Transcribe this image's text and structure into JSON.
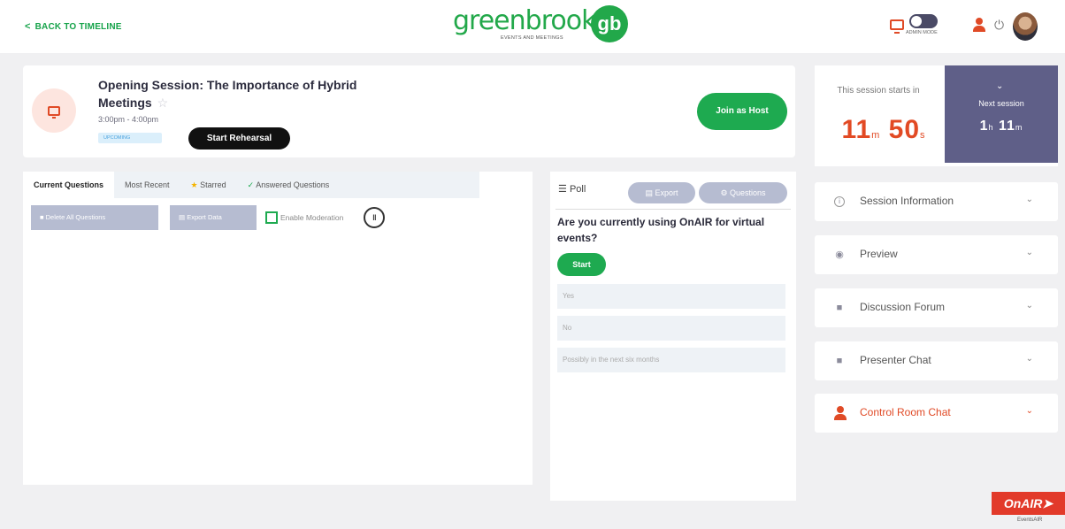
{
  "topbar": {
    "back_label": "BACK TO TIMELINE",
    "logo_text": "greenbrook",
    "logo_badge": "gb",
    "logo_tagline": "EVENTS AND MEETINGS",
    "admin_mode_label": "ADMIN MODE",
    "icons": [
      "monitor-icon",
      "toggle-switch",
      "user-icon",
      "logout-icon",
      "avatar"
    ]
  },
  "session": {
    "title": "Opening Session: The Importance of Hybrid Meetings",
    "time": "3:00pm - 4:00pm",
    "status_badge": "UPCOMING",
    "rehearsal_label": "Start Rehearsal",
    "join_label": "Join as Host"
  },
  "countdown": {
    "caption": "This session starts in",
    "minutes": "11",
    "minutes_unit": "m",
    "seconds": "50",
    "seconds_unit": "s",
    "next_label": "Next session",
    "next_hours": "1",
    "next_hours_unit": "h",
    "next_minutes": "11",
    "next_minutes_unit": "m"
  },
  "questions": {
    "tabs": [
      "Current Questions",
      "Most Recent",
      "Starred",
      "Answered Questions"
    ],
    "delete_all_label": "Delete All Questions",
    "export_data_label": "Export Data",
    "moderation_label": "Enable Moderation"
  },
  "poll": {
    "label": "Poll",
    "export_label": "Export",
    "questions_label": "Questions",
    "question": "Are you currently using OnAIR for virtual events?",
    "start_label": "Start",
    "options": [
      "Yes",
      "No",
      "Possibly in the next six months"
    ]
  },
  "sidebar": {
    "items": [
      {
        "label": "Session Information"
      },
      {
        "label": "Preview"
      },
      {
        "label": "Discussion Forum"
      },
      {
        "label": "Presenter Chat"
      },
      {
        "label": "Control Room Chat"
      }
    ]
  },
  "brand": {
    "onair_label": "OnAIR",
    "onair_sub": "EventsAIR"
  },
  "colors": {
    "accent_green": "#1eaa50",
    "accent_orange": "#e04a26",
    "next_session_bg": "#5f5f88"
  }
}
